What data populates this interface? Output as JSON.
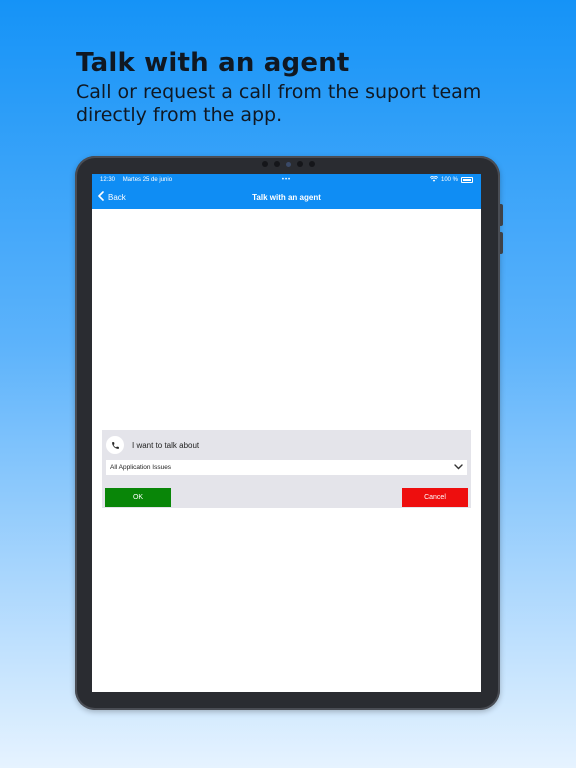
{
  "marketing": {
    "headline": "Talk with an agent",
    "subline": "Call or request a call from the suport team directly from the app."
  },
  "status_bar": {
    "time": "12:30",
    "date": "Martes 25 de junio",
    "center_dots": "•••",
    "battery_text": "100 %"
  },
  "nav": {
    "back_label": "Back",
    "title": "Talk with an agent"
  },
  "dialog": {
    "title": "I want to talk about",
    "selected_option": "All Application Issues",
    "ok_label": "OK",
    "cancel_label": "Cancel"
  },
  "colors": {
    "brand_blue": "#0f8df4",
    "ok_green": "#098608",
    "cancel_red": "#ee0e0e",
    "dialog_bg": "#e4e4ea"
  },
  "icons": {
    "back": "chevron-left-icon",
    "phone": "phone-icon",
    "dropdown": "chevron-down-icon",
    "wifi": "wifi-icon",
    "battery": "battery-icon"
  }
}
